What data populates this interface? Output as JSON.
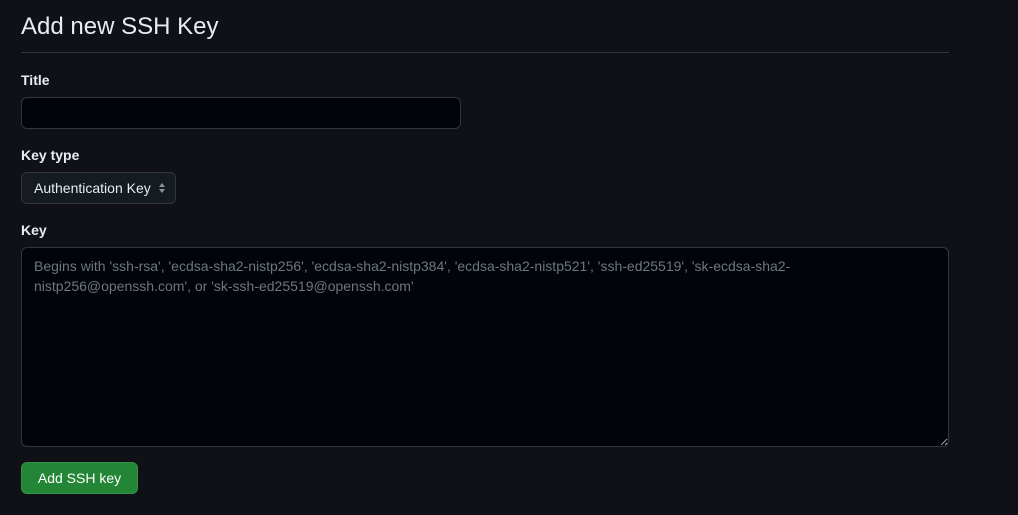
{
  "form": {
    "heading": "Add new SSH Key",
    "title_label": "Title",
    "title_value": "",
    "title_placeholder": "",
    "key_type_label": "Key type",
    "key_type_selected": "Authentication Key",
    "key_label": "Key",
    "key_value": "",
    "key_placeholder": "Begins with 'ssh-rsa', 'ecdsa-sha2-nistp256', 'ecdsa-sha2-nistp384', 'ecdsa-sha2-nistp521', 'ssh-ed25519', 'sk-ecdsa-sha2-nistp256@openssh.com', or 'sk-ssh-ed25519@openssh.com'",
    "submit_label": "Add SSH key"
  },
  "icons": {
    "select_arrow": "select-up-down-icon"
  },
  "colors": {
    "background": "#0f1117",
    "input_background": "#010409",
    "border": "#30363d",
    "text": "#e6edf3",
    "placeholder": "#6e7681",
    "primary_button": "#238636"
  }
}
